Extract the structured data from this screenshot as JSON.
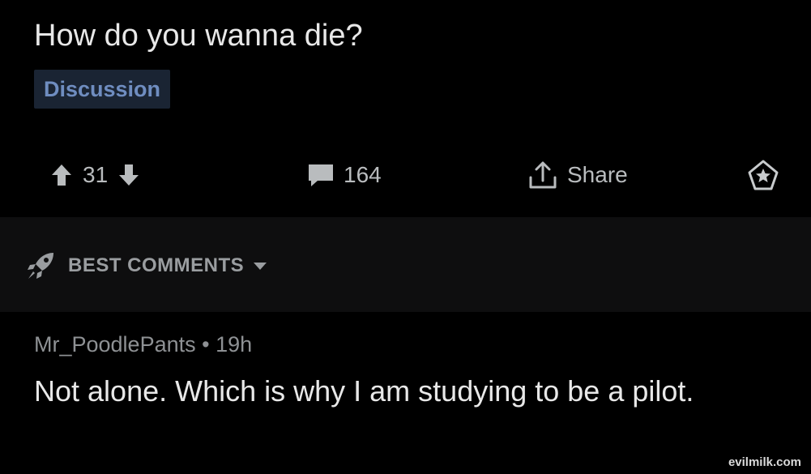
{
  "post": {
    "title": "How do you wanna die?",
    "flair": "Discussion",
    "vote_count": "31",
    "comment_count": "164",
    "share_label": "Share"
  },
  "sort": {
    "label": "BEST COMMENTS"
  },
  "comment": {
    "author": "Mr_PoodlePants",
    "separator": "•",
    "age": "19h",
    "body": "Not alone.  Which is why I am studying to be a pilot."
  },
  "watermark": "evilmilk.com",
  "icons": {
    "upvote": "arrow-up-icon",
    "downvote": "arrow-down-icon",
    "comments": "speech-bubble-icon",
    "share": "share-upload-icon",
    "award": "award-icon",
    "sort": "rocket-icon",
    "dropdown": "caret-down-icon"
  },
  "colors": {
    "background": "#000000",
    "band": "#0e0e0f",
    "title": "#e8e8e8",
    "flair_bg": "#1a2433",
    "flair_text": "#6f8dc0",
    "muted": "#8e9194"
  }
}
